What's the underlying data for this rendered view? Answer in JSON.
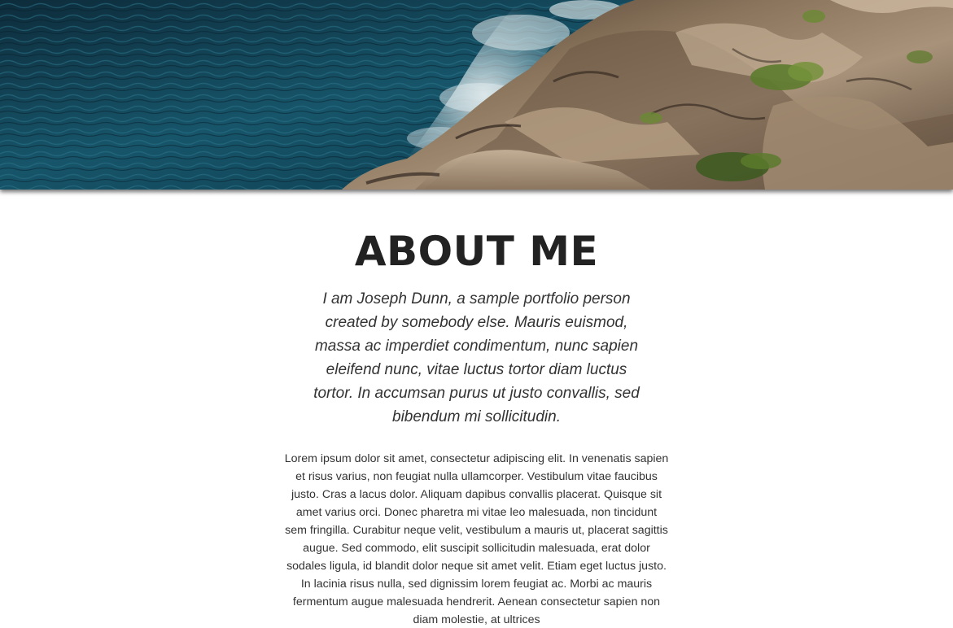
{
  "hero": {
    "image": "ocean-rocky-coast-photo",
    "colors": {
      "water_dark": "#0b2a3a",
      "water_mid": "#1b5a6e",
      "rock_dark": "#3c2e22",
      "rock_light": "#b9a38a",
      "foam": "#e8eef0",
      "shrub": "#5b7a2c"
    }
  },
  "about": {
    "title": "ABOUT ME",
    "lead": "I am Joseph Dunn, a sample portfolio person created by somebody else. Mauris euismod, massa ac imperdiet condimentum, nunc sapien eleifend nunc, vitae luctus tortor diam luctus tortor. In accumsan purus ut justo convallis, sed bibendum mi sollicitudin.",
    "body": "Lorem ipsum dolor sit amet, consectetur adipiscing elit. In venenatis sapien et risus varius, non feugiat nulla ullamcorper. Vestibulum vitae faucibus justo. Cras a lacus dolor. Aliquam dapibus convallis placerat. Quisque sit amet varius orci. Donec pharetra mi vitae leo malesuada, non tincidunt sem fringilla. Curabitur neque velit, vestibulum a mauris ut, placerat sagittis augue. Sed commodo, elit suscipit sollicitudin malesuada, erat dolor sodales ligula, id blandit dolor neque sit amet velit. Etiam eget luctus justo. In lacinia risus nulla, sed dignissim lorem feugiat ac. Morbi ac mauris fermentum augue malesuada hendrerit. Aenean consectetur sapien non diam molestie, at ultrices"
  }
}
